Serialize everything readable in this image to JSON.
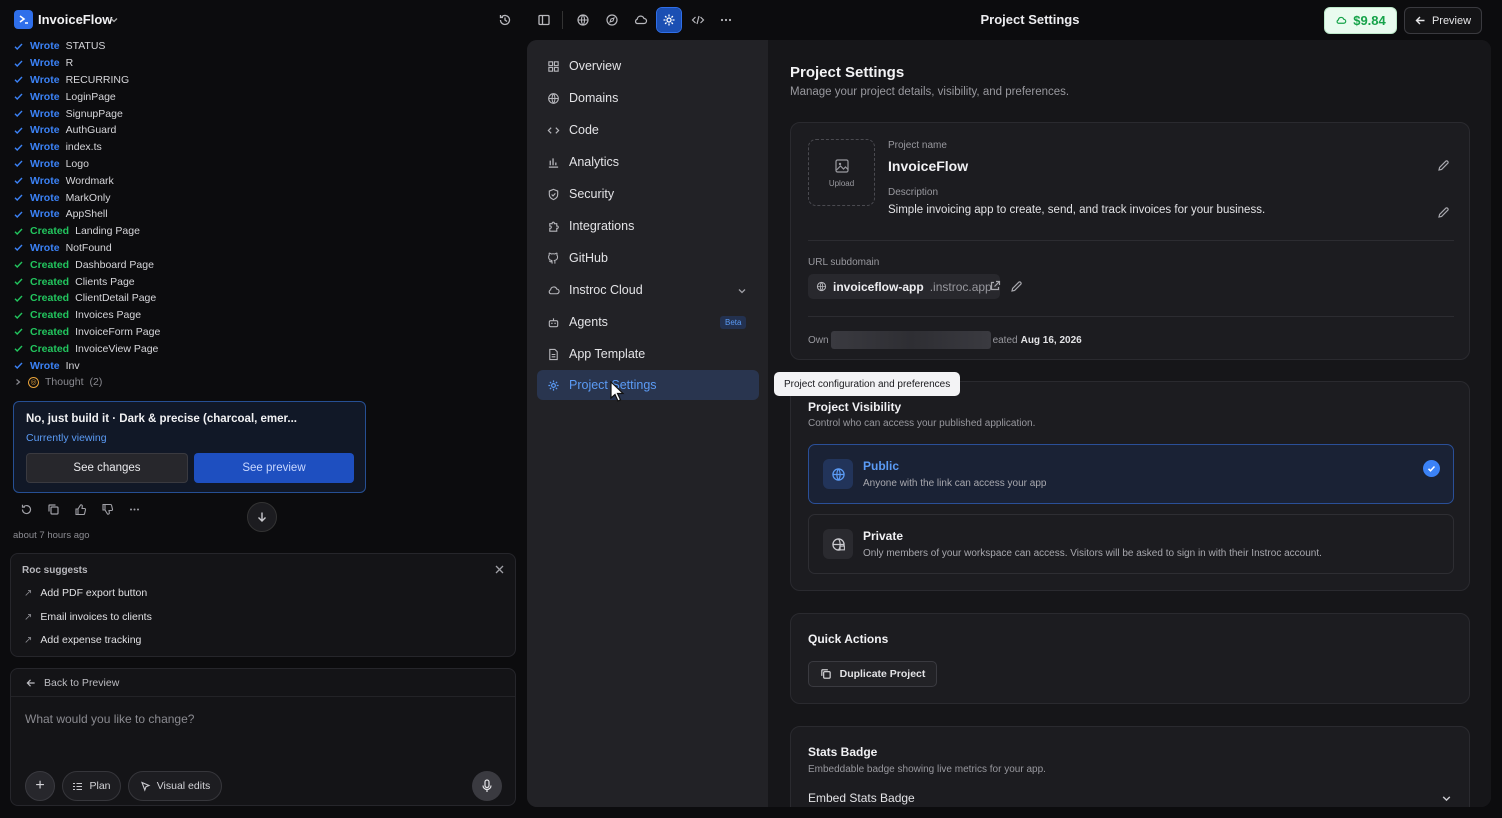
{
  "topbar": {
    "app_name": "InvoiceFlow",
    "page_title": "Project Settings",
    "credits": "$9.84",
    "preview_label": "Preview",
    "icons": [
      "history-icon",
      "sidebar-icon",
      "globe-icon",
      "compass-icon",
      "cloud-icon",
      "settings-icon",
      "code-icon",
      "more-icon"
    ]
  },
  "chat": {
    "log": [
      {
        "verb": "Wrote",
        "item": "STATUS"
      },
      {
        "verb": "Wrote",
        "item": "R"
      },
      {
        "verb": "Wrote",
        "item": "RECURRING"
      },
      {
        "verb": "Wrote",
        "item": "LoginPage"
      },
      {
        "verb": "Wrote",
        "item": "SignupPage"
      },
      {
        "verb": "Wrote",
        "item": "AuthGuard"
      },
      {
        "verb": "Wrote",
        "item": "index.ts"
      },
      {
        "verb": "Wrote",
        "item": "Logo"
      },
      {
        "verb": "Wrote",
        "item": "Wordmark"
      },
      {
        "verb": "Wrote",
        "item": "MarkOnly"
      },
      {
        "verb": "Wrote",
        "item": "AppShell"
      },
      {
        "verb": "Created",
        "item": "Landing Page"
      },
      {
        "verb": "Wrote",
        "item": "NotFound"
      },
      {
        "verb": "Created",
        "item": "Dashboard Page"
      },
      {
        "verb": "Created",
        "item": "Clients Page"
      },
      {
        "verb": "Created",
        "item": "ClientDetail Page"
      },
      {
        "verb": "Created",
        "item": "Invoices Page"
      },
      {
        "verb": "Created",
        "item": "InvoiceForm Page"
      },
      {
        "verb": "Created",
        "item": "InvoiceView Page"
      },
      {
        "verb": "Wrote",
        "item": "Inv"
      }
    ],
    "thought_label": "Thought",
    "thought_count": "(2)",
    "message": "No, just build it · Dark & precise (charcoal, emer...",
    "currently_viewing": "Currently viewing",
    "see_changes": "See changes",
    "see_preview": "See preview",
    "timestamp": "about 7 hours ago",
    "suggest_title": "Roc suggests",
    "suggestions": [
      "Add PDF export button",
      "Email invoices to clients",
      "Add expense tracking"
    ],
    "back_label": "Back to Preview",
    "placeholder": "What would you like to change?",
    "plan_label": "Plan",
    "visual_edits_label": "Visual edits"
  },
  "nav": {
    "items": [
      {
        "label": "Overview",
        "icon": "grid-icon"
      },
      {
        "label": "Domains",
        "icon": "globe-icon"
      },
      {
        "label": "Code",
        "icon": "code-icon"
      },
      {
        "label": "Analytics",
        "icon": "chart-icon"
      },
      {
        "label": "Security",
        "icon": "shield-icon"
      },
      {
        "label": "Integrations",
        "icon": "puzzle-icon"
      },
      {
        "label": "GitHub",
        "icon": "github-icon"
      },
      {
        "label": "Instroc Cloud",
        "icon": "cloud-icon"
      },
      {
        "label": "Agents",
        "icon": "robot-icon"
      },
      {
        "label": "App Template",
        "icon": "document-icon"
      },
      {
        "label": "Project Settings",
        "icon": "gear-icon"
      }
    ],
    "beta_label": "Beta",
    "tooltip": "Project configuration and preferences"
  },
  "settings": {
    "title": "Project Settings",
    "subtitle": "Manage your project details, visibility, and preferences.",
    "upload_label": "Upload",
    "project_name_label": "Project name",
    "project_name": "InvoiceFlow",
    "description_label": "Description",
    "description": "Simple invoicing app to create, send, and track invoices for your business.",
    "url_label": "URL subdomain",
    "subdomain": "invoiceflow-app",
    "domain_suffix": ".instroc.app",
    "owner_prefix": "Own",
    "created_prefix": "eated",
    "created_date": "Aug 16, 2026",
    "visibility_title": "Project Visibility",
    "visibility_sub": "Control who can access your published application.",
    "public_title": "Public",
    "public_desc": "Anyone with the link can access your app",
    "private_title": "Private",
    "private_desc": "Only members of your workspace can access. Visitors will be asked to sign in with their Instroc account.",
    "quick_title": "Quick Actions",
    "duplicate_label": "Duplicate Project",
    "stats_title": "Stats Badge",
    "stats_sub": "Embeddable badge showing live metrics for your app.",
    "embed_label": "Embed Stats Badge"
  }
}
